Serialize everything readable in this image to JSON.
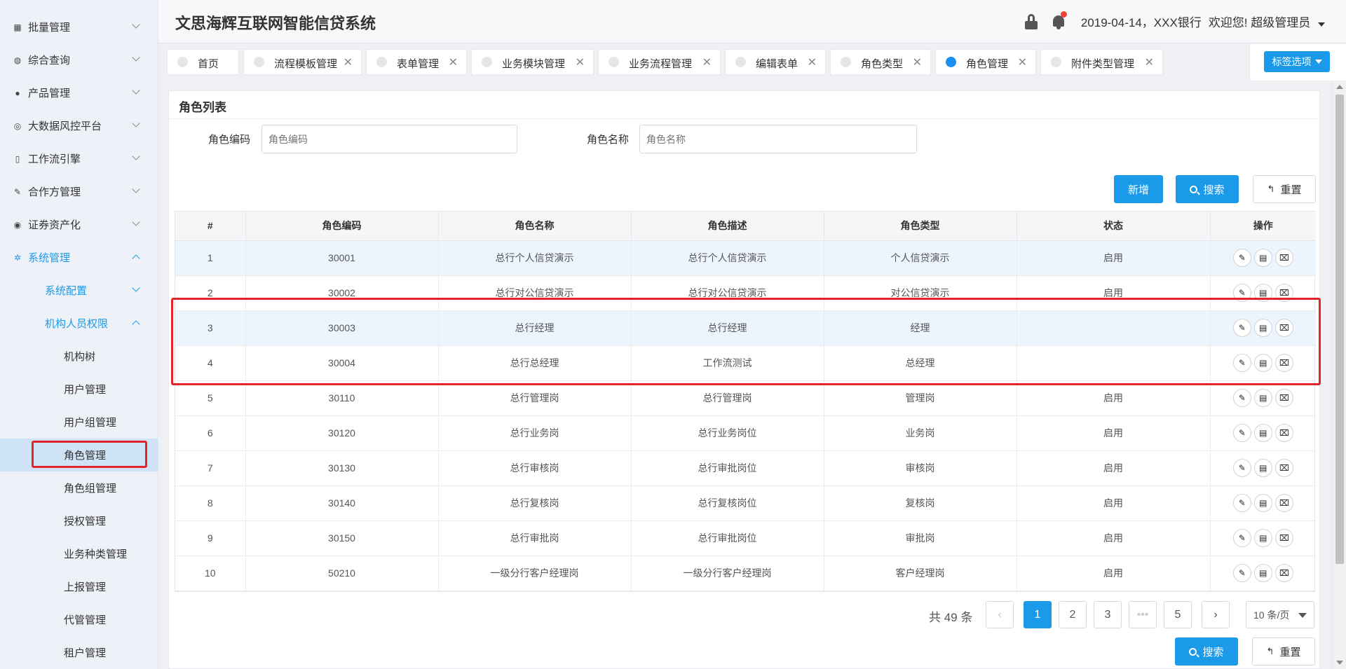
{
  "header": {
    "title": "文思海辉互联网智能信贷系统",
    "date_bank": "2019-04-14，XXX银行",
    "welcome": "欢迎您! 超级管理员"
  },
  "sidebar": {
    "items": [
      {
        "label": "批量管理",
        "icon": "grid-icon"
      },
      {
        "label": "综合查询",
        "icon": "globe-icon"
      },
      {
        "label": "产品管理",
        "icon": "circle-icon"
      },
      {
        "label": "大数据风控平台",
        "icon": "signal-icon"
      },
      {
        "label": "工作流引擎",
        "icon": "phone-icon"
      },
      {
        "label": "合作方管理",
        "icon": "brush-icon"
      },
      {
        "label": "证券资产化",
        "icon": "target-icon"
      },
      {
        "label": "系统管理",
        "icon": "gear-icon"
      }
    ],
    "sub_items": [
      {
        "label": "系统配置"
      },
      {
        "label": "机构人员权限"
      }
    ],
    "leaf_items": [
      {
        "label": "机构树"
      },
      {
        "label": "用户管理"
      },
      {
        "label": "用户组管理"
      },
      {
        "label": "角色管理"
      },
      {
        "label": "角色组管理"
      },
      {
        "label": "授权管理"
      },
      {
        "label": "业务种类管理"
      },
      {
        "label": "上报管理"
      },
      {
        "label": "代管管理"
      },
      {
        "label": "租户管理"
      }
    ]
  },
  "tabs": [
    {
      "label": "首页",
      "closable": false
    },
    {
      "label": "流程模板管理",
      "closable": true
    },
    {
      "label": "表单管理",
      "closable": true
    },
    {
      "label": "业务模块管理",
      "closable": true
    },
    {
      "label": "业务流程管理",
      "closable": true
    },
    {
      "label": "编辑表单",
      "closable": true
    },
    {
      "label": "角色类型",
      "closable": true
    },
    {
      "label": "角色管理",
      "closable": true,
      "active": true
    },
    {
      "label": "附件类型管理",
      "closable": true
    }
  ],
  "tab_options_label": "标签选项",
  "panel": {
    "title": "角色列表",
    "filters": {
      "code_label": "角色编码",
      "code_placeholder": "角色编码",
      "name_label": "角色名称",
      "name_placeholder": "角色名称"
    },
    "buttons": {
      "add": "新增",
      "search": "搜索",
      "reset": "重置"
    }
  },
  "table": {
    "headers": [
      "#",
      "角色编码",
      "角色名称",
      "角色描述",
      "角色类型",
      "状态",
      "操作"
    ],
    "rows": [
      {
        "no": "1",
        "code": "30001",
        "name": "总行个人信贷演示",
        "desc": "总行个人信贷演示",
        "type": "个人信贷演示",
        "status": "启用"
      },
      {
        "no": "2",
        "code": "30002",
        "name": "总行对公信贷演示",
        "desc": "总行对公信贷演示",
        "type": "对公信贷演示",
        "status": "启用"
      },
      {
        "no": "3",
        "code": "30003",
        "name": "总行经理",
        "desc": "总行经理",
        "type": "经理",
        "status": ""
      },
      {
        "no": "4",
        "code": "30004",
        "name": "总行总经理",
        "desc": "工作流测试",
        "type": "总经理",
        "status": ""
      },
      {
        "no": "5",
        "code": "30110",
        "name": "总行管理岗",
        "desc": "总行管理岗",
        "type": "管理岗",
        "status": "启用"
      },
      {
        "no": "6",
        "code": "30120",
        "name": "总行业务岗",
        "desc": "总行业务岗位",
        "type": "业务岗",
        "status": "启用"
      },
      {
        "no": "7",
        "code": "30130",
        "name": "总行审核岗",
        "desc": "总行审批岗位",
        "type": "审核岗",
        "status": "启用"
      },
      {
        "no": "8",
        "code": "30140",
        "name": "总行复核岗",
        "desc": "总行复核岗位",
        "type": "复核岗",
        "status": "启用"
      },
      {
        "no": "9",
        "code": "30150",
        "name": "总行审批岗",
        "desc": "总行审批岗位",
        "type": "审批岗",
        "status": "启用"
      },
      {
        "no": "10",
        "code": "50210",
        "name": "一级分行客户经理岗",
        "desc": "一级分行客户经理岗",
        "type": "客户经理岗",
        "status": "启用"
      }
    ]
  },
  "pagination": {
    "total_text": "共 49 条",
    "pages": [
      "1",
      "2",
      "3",
      "•••",
      "5"
    ],
    "current": "1",
    "page_size": "10 条/页"
  },
  "footer_buttons": {
    "search": "搜索",
    "reset": "重置"
  },
  "colors": {
    "primary": "#1a9ae8",
    "highlight_box": "#e3252b",
    "row_highlight": "#ecf5fd"
  }
}
